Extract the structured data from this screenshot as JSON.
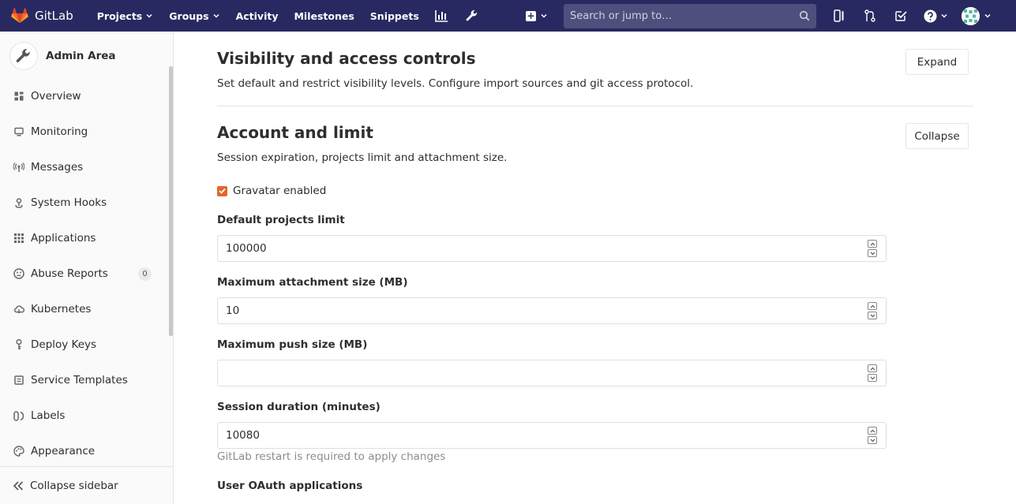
{
  "navbar": {
    "brand": "GitLab",
    "links": [
      {
        "label": "Projects",
        "dropdown": true
      },
      {
        "label": "Groups",
        "dropdown": true
      },
      {
        "label": "Activity",
        "dropdown": false
      },
      {
        "label": "Milestones",
        "dropdown": false
      },
      {
        "label": "Snippets",
        "dropdown": false
      }
    ],
    "search_placeholder": "Search or jump to…",
    "colors": {
      "background": "#292961",
      "search_bg": "#4f4f7e",
      "accent": "#e2672a"
    }
  },
  "sidebar": {
    "title": "Admin Area",
    "items": [
      {
        "label": "Overview",
        "icon": "overview-icon"
      },
      {
        "label": "Monitoring",
        "icon": "monitor-icon"
      },
      {
        "label": "Messages",
        "icon": "broadcast-icon"
      },
      {
        "label": "System Hooks",
        "icon": "hook-icon"
      },
      {
        "label": "Applications",
        "icon": "grid-icon"
      },
      {
        "label": "Abuse Reports",
        "icon": "abuse-icon",
        "badge": "0"
      },
      {
        "label": "Kubernetes",
        "icon": "cloud-icon"
      },
      {
        "label": "Deploy Keys",
        "icon": "key-icon"
      },
      {
        "label": "Service Templates",
        "icon": "template-icon"
      },
      {
        "label": "Labels",
        "icon": "label-icon"
      },
      {
        "label": "Appearance",
        "icon": "palette-icon"
      }
    ],
    "collapse_label": "Collapse sidebar"
  },
  "main": {
    "visibility": {
      "title": "Visibility and access controls",
      "description": "Set default and restrict visibility levels. Configure import sources and git access protocol.",
      "button": "Expand"
    },
    "account": {
      "title": "Account and limit",
      "description": "Session expiration, projects limit and attachment size.",
      "button": "Collapse",
      "gravatar_label": "Gravatar enabled",
      "gravatar_checked": true,
      "fields": [
        {
          "label": "Default projects limit",
          "value": "100000"
        },
        {
          "label": "Maximum attachment size (MB)",
          "value": "10"
        },
        {
          "label": "Maximum push size (MB)",
          "value": ""
        },
        {
          "label": "Session duration (minutes)",
          "value": "10080"
        }
      ],
      "session_help": "GitLab restart is required to apply changes",
      "oauth_label": "User OAuth applications"
    }
  }
}
